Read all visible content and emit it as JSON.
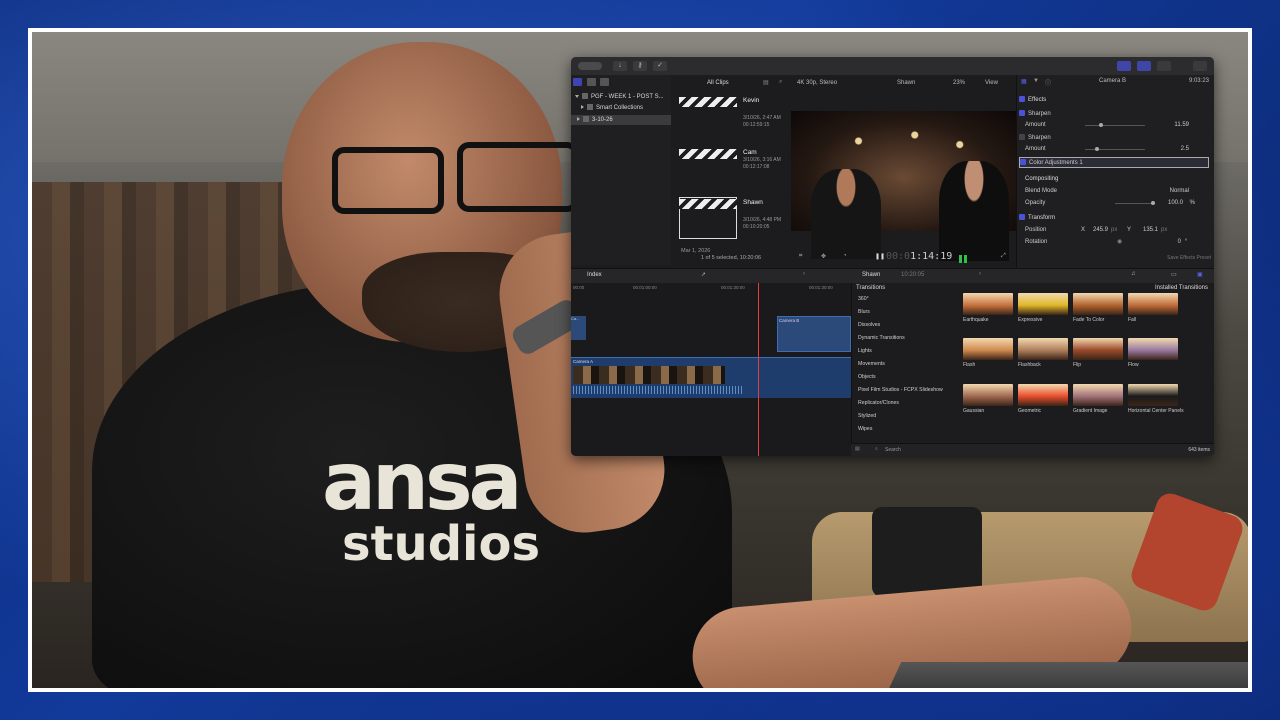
{
  "fcp": {
    "titlebar": {
      "buttons": [
        "import-arrow",
        "key",
        "check"
      ]
    },
    "library": {
      "name": "PGF - WEEK 1 - POST S...",
      "smart_collections": "Smart Collections",
      "event": "3-10-26"
    },
    "browser": {
      "filter": "All Clips",
      "clips": [
        {
          "name": "Kevin",
          "date": "3/10/26, 2:47 AM",
          "duration": "00:12:59:15"
        },
        {
          "name": "Cam",
          "date": "3/10/26, 3:16 AM",
          "duration": "00:12:17:08"
        },
        {
          "name": "Shawn",
          "date": "3/10/26, 4:48 PM",
          "duration": "00:10:20:05"
        }
      ],
      "date_group": "Mar 1, 2026",
      "status": "1 of 5 selected, 10:20:06"
    },
    "viewer": {
      "format": "4K 30p, Stereo",
      "clip": "Shawn",
      "zoom": "23%",
      "view": "View",
      "timecode_dim": "00:0",
      "timecode": "1:14:19"
    },
    "inspector": {
      "title": "Camera B",
      "duration": "9:03:23",
      "effects": "Effects",
      "sharpen1": "Sharpen",
      "amount_label": "Amount",
      "amount1": "11.59",
      "sharpen2": "Sharpen",
      "amount2": "2.5",
      "color_adj": "Color Adjustments 1",
      "compositing": "Compositing",
      "blend_mode_label": "Blend Mode",
      "blend_mode": "Normal",
      "opacity_label": "Opacity",
      "opacity": "100.0",
      "opacity_unit": "%",
      "transform": "Transform",
      "position_label": "Position",
      "x_label": "X",
      "pos_x": "245.9",
      "y_label": "Y",
      "pos_y": "135.1",
      "px_unit": "px",
      "rotation_label": "Rotation",
      "rotation": "0",
      "rotation_unit": "°",
      "save_preset": "Save Effects Preset"
    },
    "timeline": {
      "index": "Index",
      "project": "Shawn",
      "project_duration": "10:20:05",
      "ruler": [
        "00:00",
        "00:01:00:00",
        "00:01:30:00",
        "00:01:30:00"
      ],
      "clip_b": "Camera B",
      "clip_a": "Camera A",
      "clip_small": "Ca..."
    },
    "transitions": {
      "title": "Transitions",
      "installed": "Installed Transitions",
      "categories": [
        "360°",
        "Blurs",
        "Dissolves",
        "Dynamic Transitions",
        "Lights",
        "Movements",
        "Objects",
        "Pixel Film Studios - FCPX Slideshow",
        "Replicator/Clones",
        "Stylized",
        "Wipes"
      ],
      "tiles": [
        {
          "name": "Earthquake",
          "color": "#c9733d"
        },
        {
          "name": "Expressive",
          "color": "#e2b72a"
        },
        {
          "name": "Fade To Color",
          "color": "#b5652e"
        },
        {
          "name": "Fall",
          "color": "#c26d3a"
        },
        {
          "name": "Flash",
          "color": "#d08a4e"
        },
        {
          "name": "Flashback",
          "color": "#b0805c"
        },
        {
          "name": "Flip",
          "color": "#9a4a2a"
        },
        {
          "name": "Flow",
          "color": "#9a7aa0"
        },
        {
          "name": "Gaussian",
          "color": "#a46a52"
        },
        {
          "name": "Geometric",
          "color": "#ea4f2c"
        },
        {
          "name": "Gradient Image",
          "color": "#a3737a"
        },
        {
          "name": "Horizontal Center Panels",
          "color": "#1b1b1b"
        }
      ],
      "search_placeholder": "Search",
      "count": "643 items"
    }
  },
  "shirt": {
    "line1": "ansa",
    "line2": "studios"
  }
}
